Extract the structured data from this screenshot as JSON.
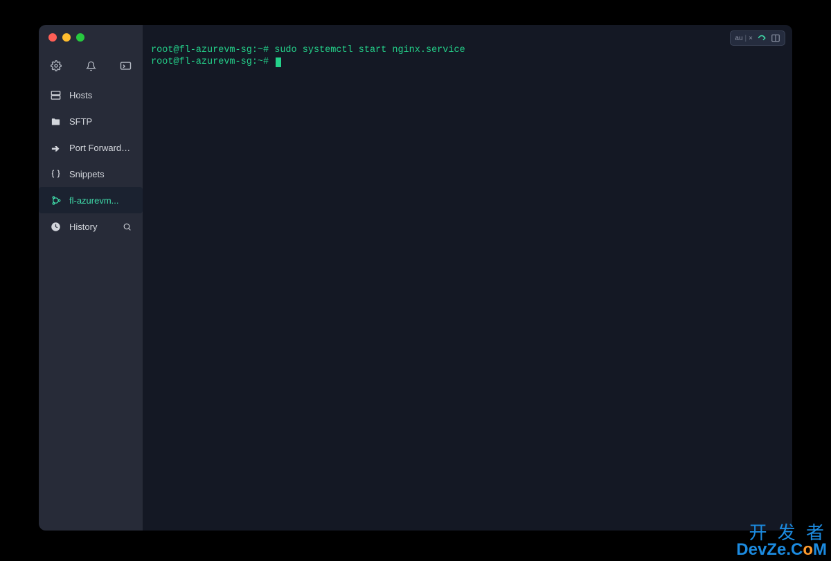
{
  "sidebar": {
    "items": [
      {
        "icon": "server-icon",
        "label": "Hosts"
      },
      {
        "icon": "folder-icon",
        "label": "SFTP"
      },
      {
        "icon": "forward-icon",
        "label": "Port Forwarding"
      },
      {
        "icon": "braces-icon",
        "label": "Snippets"
      },
      {
        "icon": "ubuntu-icon",
        "label": "fl-azurevm...",
        "active": true
      },
      {
        "icon": "clock-icon",
        "label": "History",
        "trailing": "search-icon"
      }
    ]
  },
  "toolbar": {
    "badge_text": "au",
    "badge_suffix": "×"
  },
  "terminal": {
    "prompt": "root@fl-azurevm-sg:~#",
    "lines": [
      {
        "prompt": "root@fl-azurevm-sg:~#",
        "cmd": " sudo systemctl start nginx.service"
      },
      {
        "prompt": "root@fl-azurevm-sg:~#",
        "cmd": " ",
        "cursor": true
      }
    ]
  },
  "watermark": {
    "line1": "开 发 者",
    "line2_pre": "DevZe.C",
    "line2_o": "o",
    "line2_post": "M"
  }
}
